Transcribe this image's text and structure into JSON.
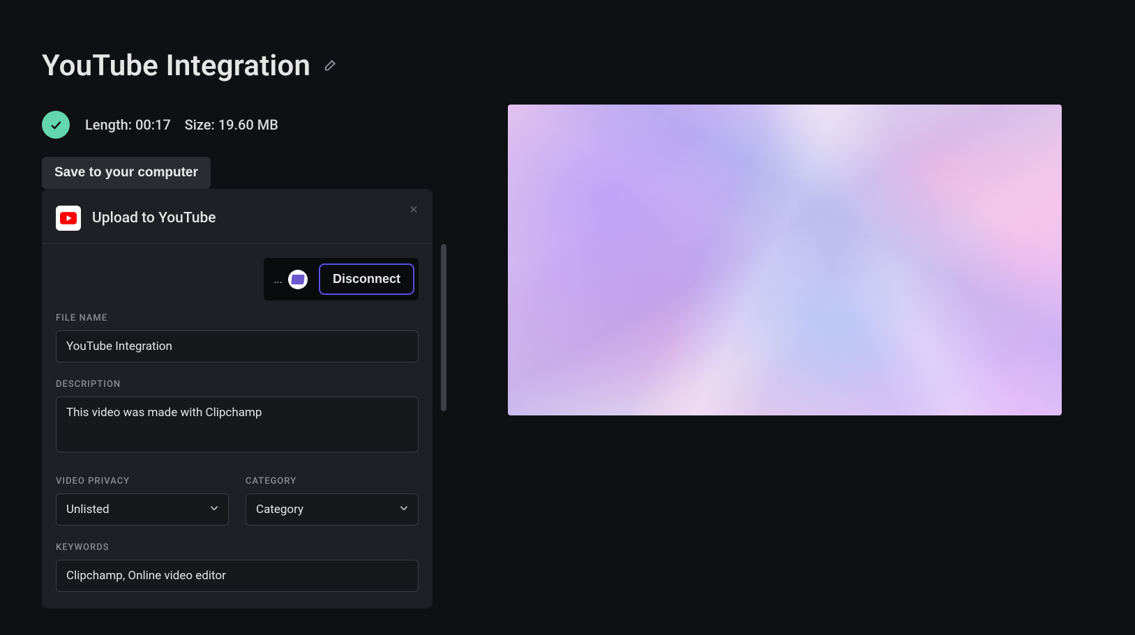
{
  "title": "YouTube Integration",
  "status": {
    "length_label": "Length:",
    "length_value": "00:17",
    "size_label": "Size:",
    "size_value": "19.60 MB"
  },
  "actions": {
    "save_local": "Save to your computer"
  },
  "upload_panel": {
    "title": "Upload to YouTube",
    "account_prefix": "...",
    "disconnect": "Disconnect",
    "labels": {
      "file_name": "FILE NAME",
      "description": "DESCRIPTION",
      "privacy": "VIDEO PRIVACY",
      "category": "CATEGORY",
      "keywords": "KEYWORDS"
    },
    "fields": {
      "file_name": "YouTube Integration",
      "description": "This video was made with Clipchamp",
      "privacy_value": "Unlisted",
      "category_value": "Category",
      "keywords": "Clipchamp, Online video editor"
    }
  },
  "colors": {
    "accent": "#5a4ee6",
    "success": "#63d6af"
  }
}
